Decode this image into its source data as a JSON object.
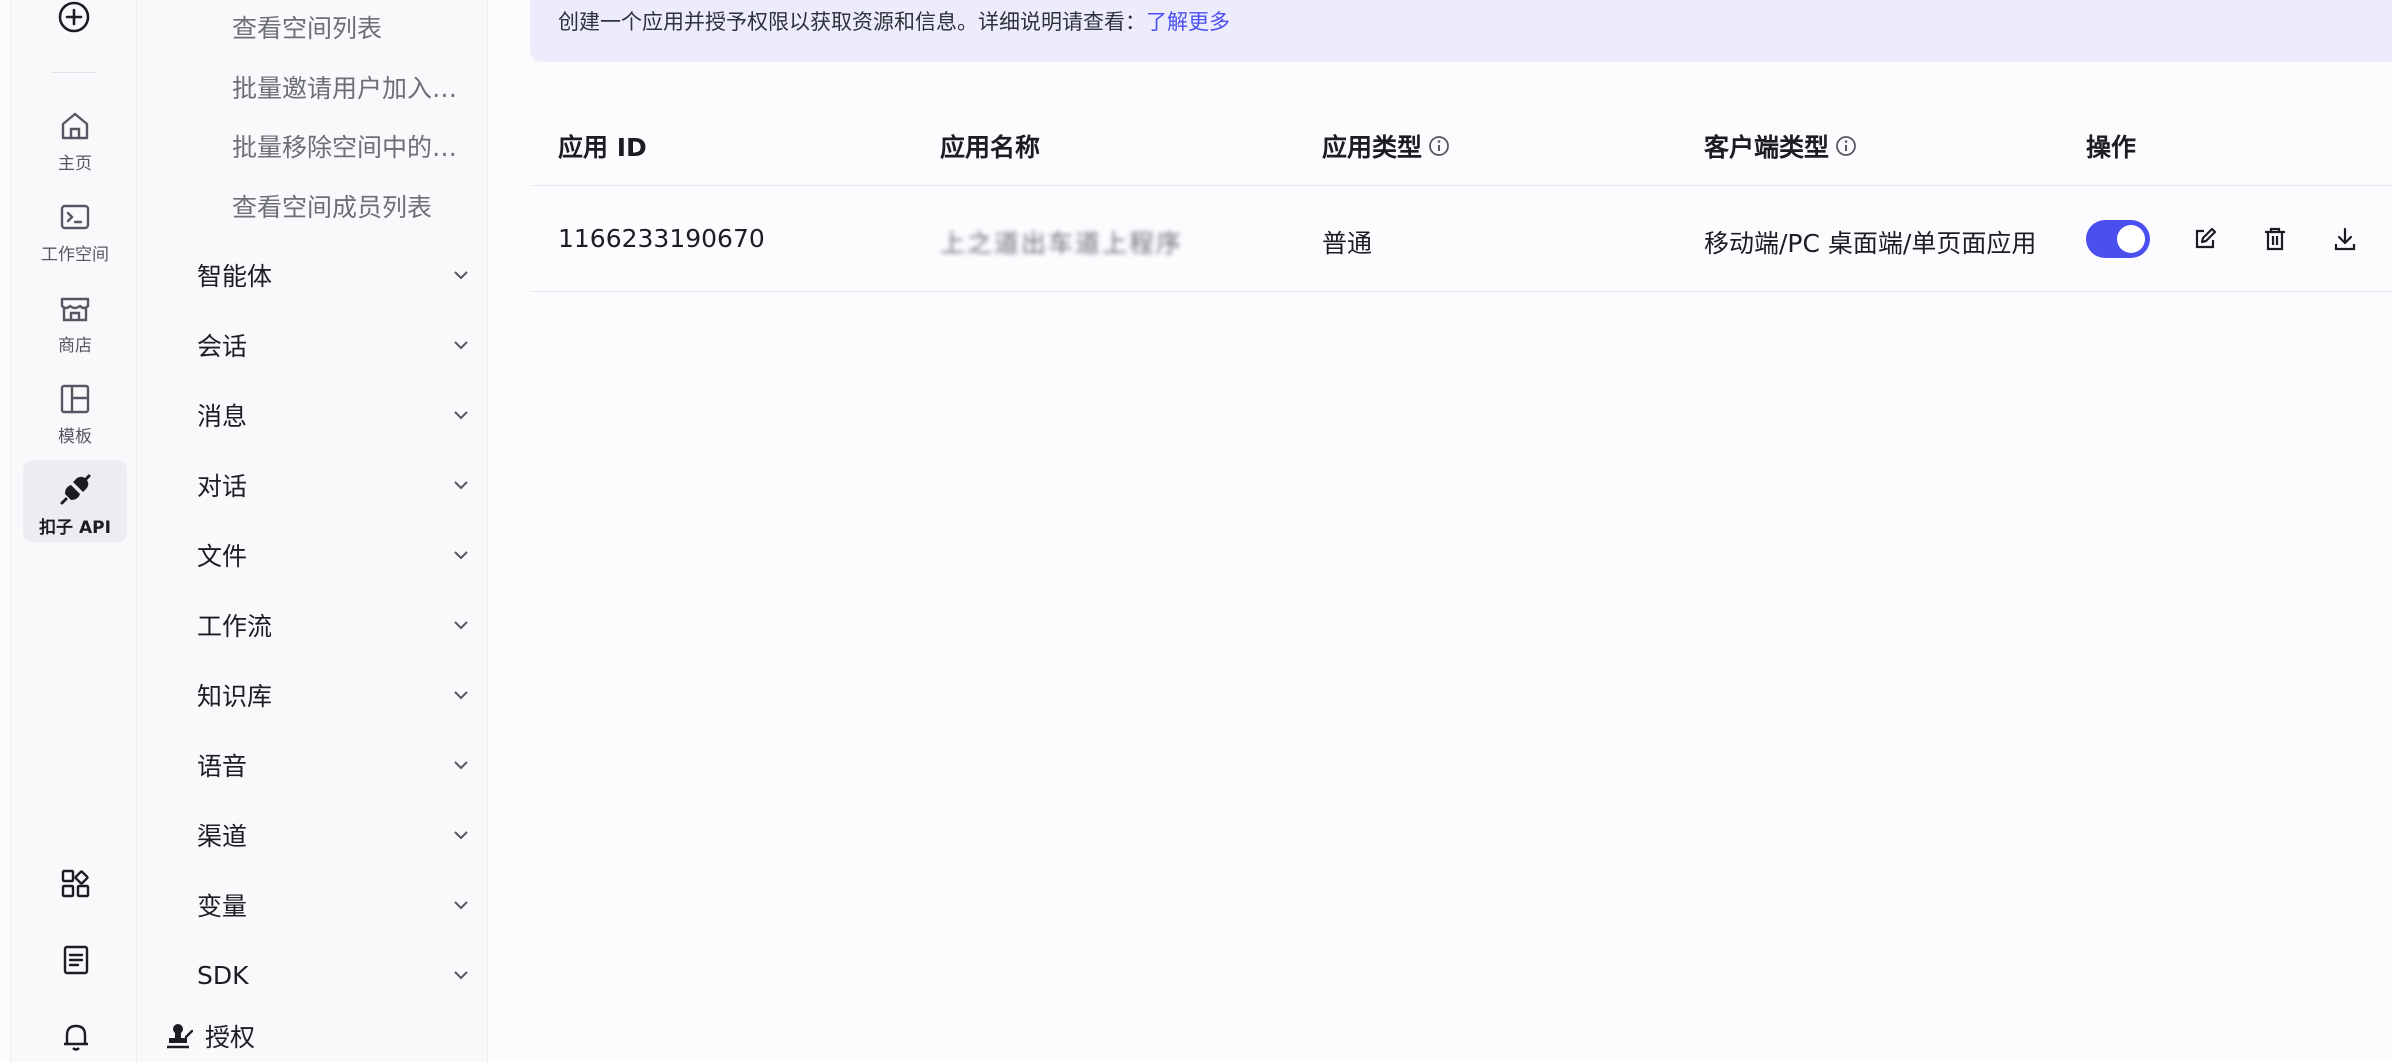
{
  "rail": {
    "nav": [
      {
        "label": "主页",
        "icon": "home-icon"
      },
      {
        "label": "工作空间",
        "icon": "terminal-icon"
      },
      {
        "label": "商店",
        "icon": "store-icon"
      },
      {
        "label": "模板",
        "icon": "template-icon"
      },
      {
        "label": "扣子 API",
        "icon": "plug-icon",
        "active": true
      }
    ],
    "bottom_icons": [
      "apps-icon",
      "document-icon",
      "bell-icon"
    ]
  },
  "sidebar": {
    "sub_links": [
      "查看空间列表",
      "批量邀请用户加入空间",
      "批量移除空间中的用户",
      "查看空间成员列表"
    ],
    "groups": [
      "智能体",
      "会话",
      "消息",
      "对话",
      "文件",
      "工作流",
      "知识库",
      "语音",
      "渠道",
      "变量",
      "SDK"
    ],
    "auth_label": "授权"
  },
  "banner": {
    "text": "创建一个应用并授予权限以获取资源和信息。详细说明请查看：",
    "link": "了解更多"
  },
  "table": {
    "headers": {
      "app_id": "应用 ID",
      "app_name": "应用名称",
      "app_type": "应用类型",
      "client_type": "客户端类型",
      "actions": "操作"
    },
    "rows": [
      {
        "app_id": "1166233190670",
        "app_name": "上之道出车道上程序",
        "app_type": "普通",
        "client_type": "移动端/PC 桌面端/单页面应用",
        "enabled": true
      }
    ]
  },
  "colors": {
    "accent": "#4b4ff0",
    "banner_bg": "#ececfd",
    "sidebar_bg": "#f9f9fc"
  }
}
